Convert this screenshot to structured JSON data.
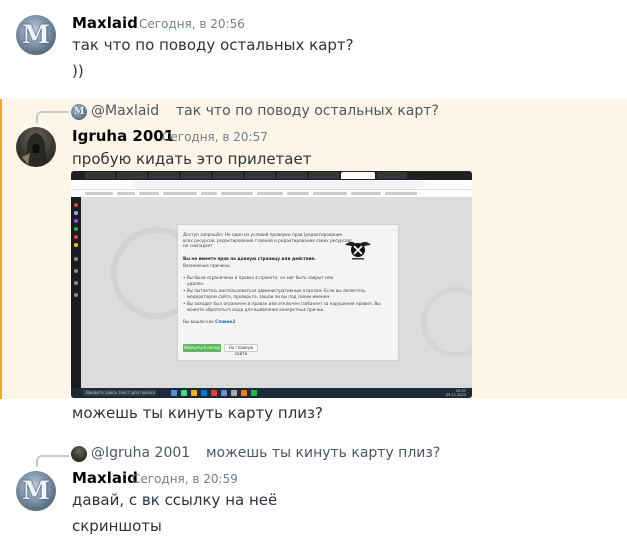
{
  "messages": [
    {
      "username": "Maxlaid",
      "timestamp": "Сегодня, в 20:56",
      "lines": [
        "так что по поводу остальных карт?",
        "))"
      ]
    },
    {
      "reply": {
        "username": "@Maxlaid",
        "text": "так что по поводу остальных карт?"
      },
      "username": "Igruha 2001",
      "timestamp": "Сегодня, в 20:57",
      "lines": [
        "пробую кидать это прилетает"
      ],
      "followup": "можешь ты кинуть карту плиз?"
    },
    {
      "reply": {
        "username": "@Igruha 2001",
        "text": "можешь ты кинуть карту плиз?"
      },
      "username": "Maxlaid",
      "timestamp": "Сегодня, в 20:59",
      "lines": [
        "давай, с вк ссылку на неё",
        "скриншоты"
      ]
    }
  ],
  "attachment": {
    "dialog": {
      "intro": "Доступ запрещён: Не один из условий проверки прав (редактирование",
      "intro2": "всех ресурсов, редактирование главной и редактирование своих ресурсов)",
      "intro3": "не совпадает",
      "title": "Вы не имеете прав на данную страницу или действие.",
      "causes_label": "Возможные причины:",
      "cause1": "Вы были ограничены в правах в проекте, он мог быть закрыт или",
      "cause1b": "удален.",
      "cause2": "Вы пытаетесь воспользоваться административным отделом. Если вы являетесь",
      "cause2b": "модератором сайта, проверьте, зашли ли вы под своим именем.",
      "cause3": "Вы заходит был ограничен в правах или отключен (забанен) за нарушение правил. Вы",
      "cause3b": "можете обратиться сюда для выявления конкретных причин.",
      "logged_in": "Вы вошли как",
      "user": "Славик2",
      "back_button": "Вернуться назад",
      "home_button": "На главную сайта"
    },
    "taskbar": {
      "search": "Введите здесь текст для поиска",
      "time": "20:57",
      "date": "09.11.2023"
    }
  }
}
